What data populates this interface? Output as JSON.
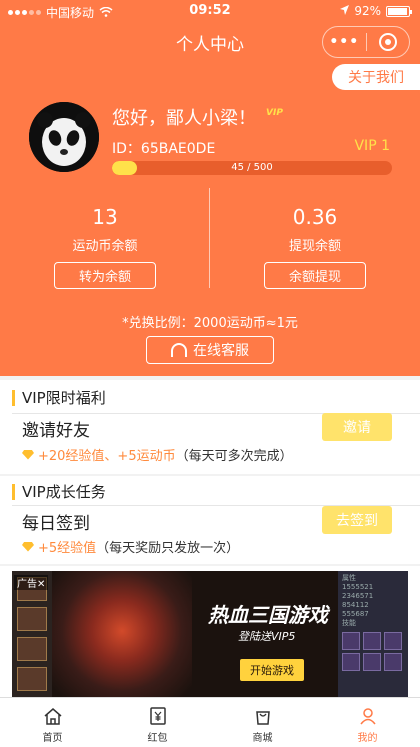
{
  "status": {
    "carrier": "中国移动",
    "time": "09:52",
    "battery": "92%"
  },
  "nav": {
    "title": "个人中心",
    "more": "•••"
  },
  "about_label": "关于我们",
  "profile": {
    "greeting": "您好，鄙人小梁！",
    "vip_mini": "VIP",
    "id_text": "ID：65BAE0DE",
    "vip_level": "VIP 1",
    "progress_text": "45 / 500",
    "progress_fraction": 0.09
  },
  "balances": {
    "coins_value": "13",
    "coins_label": "运动币余额",
    "coins_button": "转为余额",
    "cash_value": "0.36",
    "cash_label": "提现余额",
    "cash_button": "余额提现"
  },
  "ratio_text": "*兑换比例：2000运动币≈1元",
  "service_label": "在线客服",
  "vip_benefit": {
    "title": "VIP限时福利",
    "task": "邀请好友",
    "button": "邀请",
    "reward": "+20经验值、+5运动币",
    "note": "（每天可多次完成）"
  },
  "vip_growth": {
    "title": "VIP成长任务",
    "task": "每日签到",
    "button": "去签到",
    "reward": "+5经验值",
    "note": "（每天奖励只发放一次）"
  },
  "banner": {
    "ad_tag": "广告✕",
    "title": "热血三国游戏",
    "subtitle": "登陆送VIP5",
    "play": "开始游戏",
    "panel_header": "属性",
    "panel_rows": [
      "1555521",
      "2346571",
      "854112",
      "555687"
    ],
    "panel_skill": "技能"
  },
  "tabs": [
    {
      "label": "首页",
      "icon": "home-icon"
    },
    {
      "label": "红包",
      "icon": "yuan-wallet-icon"
    },
    {
      "label": "商城",
      "icon": "bag-icon"
    },
    {
      "label": "我的",
      "icon": "person-icon"
    }
  ],
  "colors": {
    "primary": "#ff7a47",
    "accent": "#ffe14a",
    "button": "#ffe36b"
  }
}
